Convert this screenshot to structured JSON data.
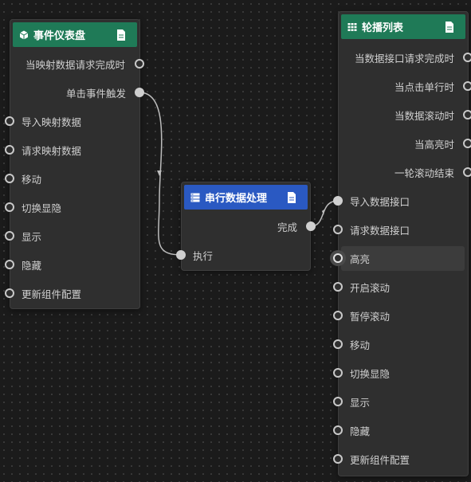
{
  "nodes": {
    "event_dashboard": {
      "title": "事件仪表盘",
      "outputs": [
        "当映射数据请求完成时",
        "单击事件触发"
      ],
      "inputs": [
        "导入映射数据",
        "请求映射数据",
        "移动",
        "切换显隐",
        "显示",
        "隐藏",
        "更新组件配置"
      ]
    },
    "serial_processing": {
      "title": "串行数据处理",
      "outputs": [
        "完成"
      ],
      "inputs": [
        "执行"
      ]
    },
    "carousel_list": {
      "title": "轮播列表",
      "outputs": [
        "当数据接口请求完成时",
        "当点击单行时",
        "当数据滚动时",
        "当高亮时",
        "一轮滚动结束"
      ],
      "inputs": [
        "导入数据接口",
        "请求数据接口",
        "高亮",
        "开启滚动",
        "暂停滚动",
        "移动",
        "切换显隐",
        "显示",
        "隐藏",
        "更新组件配置"
      ]
    }
  },
  "colors": {
    "header_green": "#1f7a57",
    "header_blue": "#2a59c2",
    "node_bg": "#2f2f2f",
    "wire": "#bdbdbd"
  }
}
